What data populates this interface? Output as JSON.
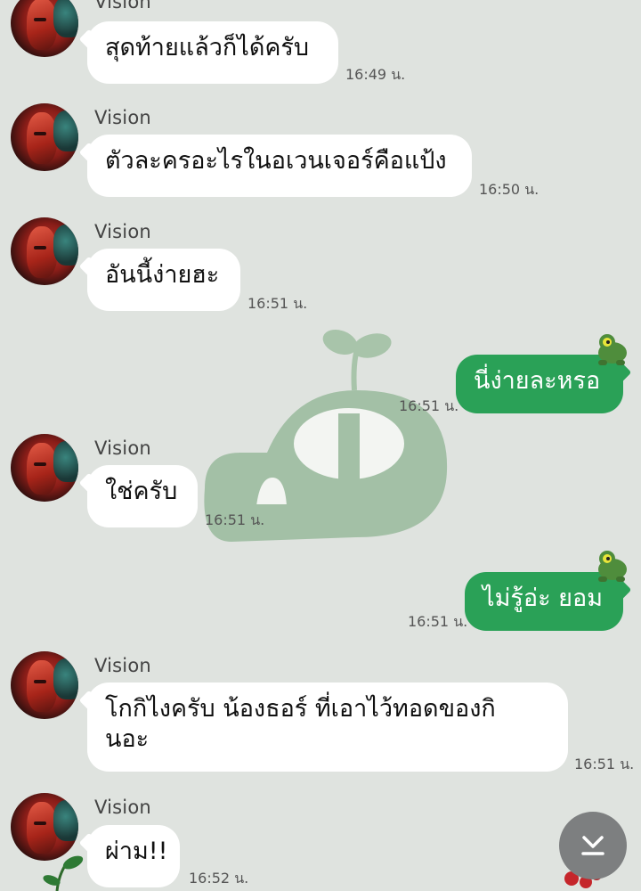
{
  "messages": [
    {
      "sender": "Vision",
      "text": "สุดท้ายแล้วก็ได้ครับ",
      "time": "16:49 น."
    },
    {
      "sender": "Vision",
      "text": "ตัวละครอะไรในอเวนเจอร์คือแป้ง",
      "time": "16:50 น."
    },
    {
      "sender": "Vision",
      "text": "อันนี้ง่ายฮะ",
      "time": "16:51 น."
    },
    {
      "sender": "me",
      "text": "นี่ง่ายละหรอ",
      "time": "16:51 น."
    },
    {
      "sender": "Vision",
      "text": "ใช่ครับ",
      "time": "16:51 น."
    },
    {
      "sender": "me",
      "text": "ไม่รู้อ่ะ ยอม",
      "time": "16:51 น."
    },
    {
      "sender": "Vision",
      "text": "โกกิไงครับ น้องธอร์ ที่เอาไว้ทอดของกิ\nนอะ",
      "time": "16:51 น."
    },
    {
      "sender": "Vision",
      "text": "ผ่าม!!",
      "time": "16:52 น."
    }
  ],
  "icons": {
    "avatar": "vision-avatar",
    "sticker": "frog-sticker",
    "scroll": "scroll-to-bottom-icon",
    "watermark": "sprout-watermark"
  },
  "colors": {
    "background": "#dfe3df",
    "incoming_bubble": "#ffffff",
    "outgoing_bubble": "#2aa157",
    "scroll_button": "#7d7f80"
  }
}
